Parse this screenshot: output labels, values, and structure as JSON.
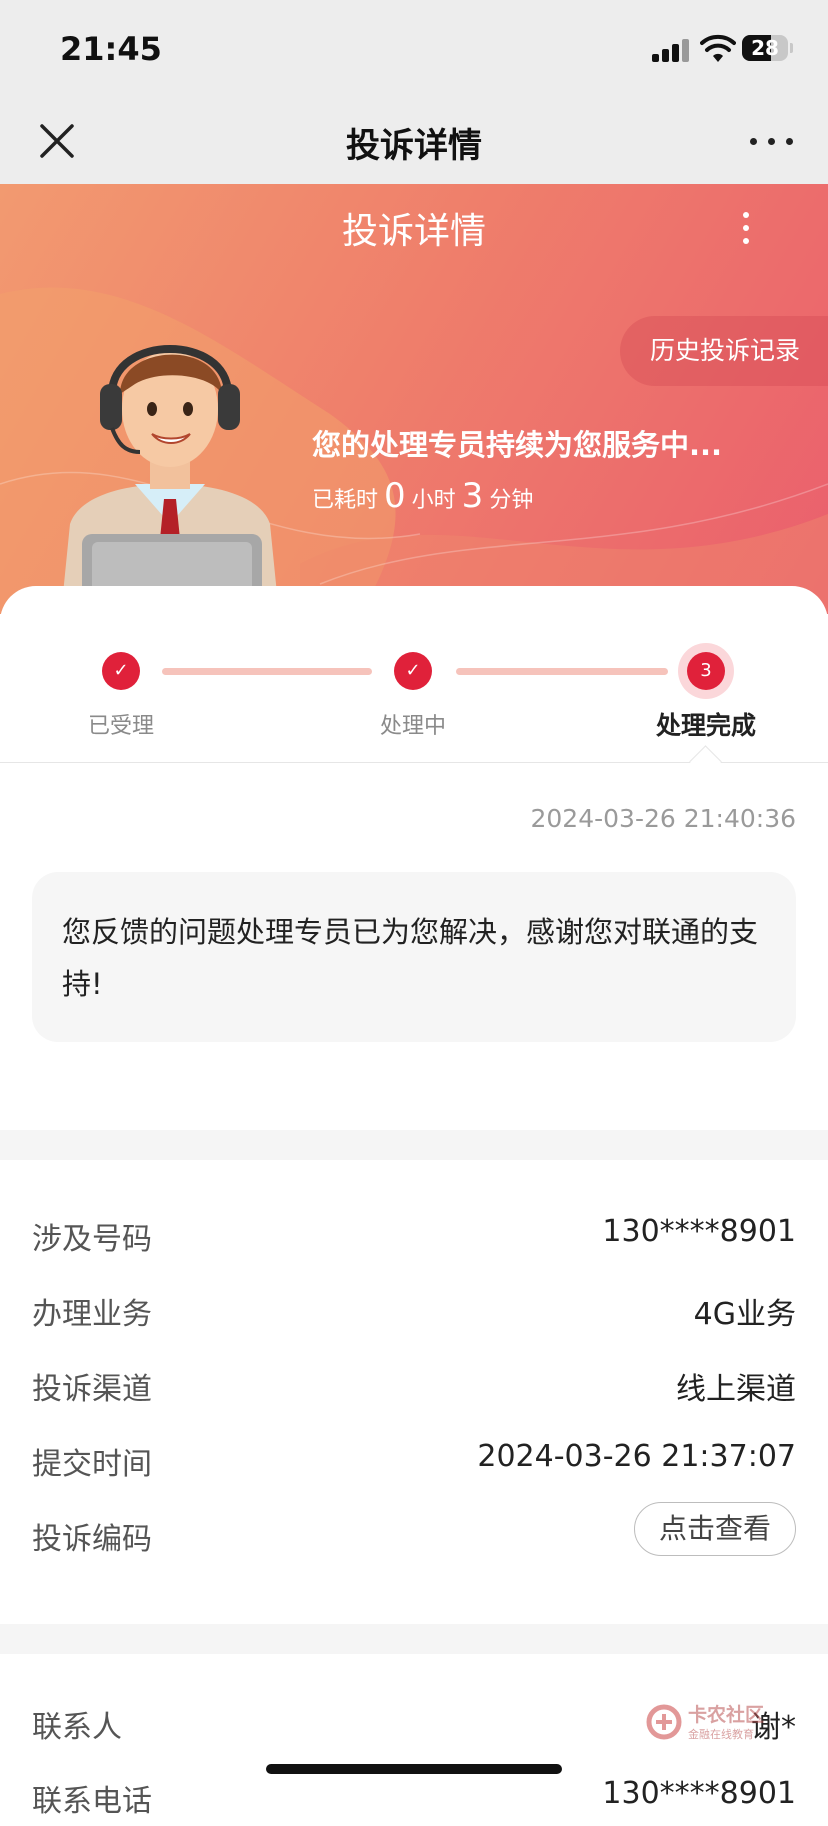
{
  "status": {
    "time": "21:45",
    "battery": "28"
  },
  "navbar": {
    "title": "投诉详情"
  },
  "hero": {
    "title": "投诉详情",
    "history_button": "历史投诉记录",
    "message": "您的处理专员持续为您服务中...",
    "elapsed": {
      "prefix": "已耗时",
      "hours": "0",
      "hours_unit": "小时",
      "minutes": "3",
      "minutes_unit": "分钟"
    }
  },
  "steps": [
    {
      "label": "已受理",
      "state": "done"
    },
    {
      "label": "处理中",
      "state": "done"
    },
    {
      "label": "处理完成",
      "state": "active",
      "number": "3"
    }
  ],
  "result": {
    "timestamp": "2024-03-26 21:40:36",
    "message": "您反馈的问题处理专员已为您解决，感谢您对联通的支持!"
  },
  "details": [
    {
      "key": "涉及号码",
      "value": "130****8901"
    },
    {
      "key": "办理业务",
      "value": "4G业务"
    },
    {
      "key": "投诉渠道",
      "value": "线上渠道"
    },
    {
      "key": "提交时间",
      "value": "2024-03-26 21:37:07"
    },
    {
      "key": "投诉编码",
      "button": "点击查看"
    }
  ],
  "contact": [
    {
      "key": "联系人",
      "value": "谢*"
    },
    {
      "key": "联系电话",
      "value": "130****8901"
    }
  ],
  "watermark": {
    "title": "卡农社区",
    "subtitle": "金融在线教育"
  },
  "colors": {
    "accent": "#e0213a",
    "hero_start": "#f29a70",
    "hero_end": "#ea5f6d"
  }
}
